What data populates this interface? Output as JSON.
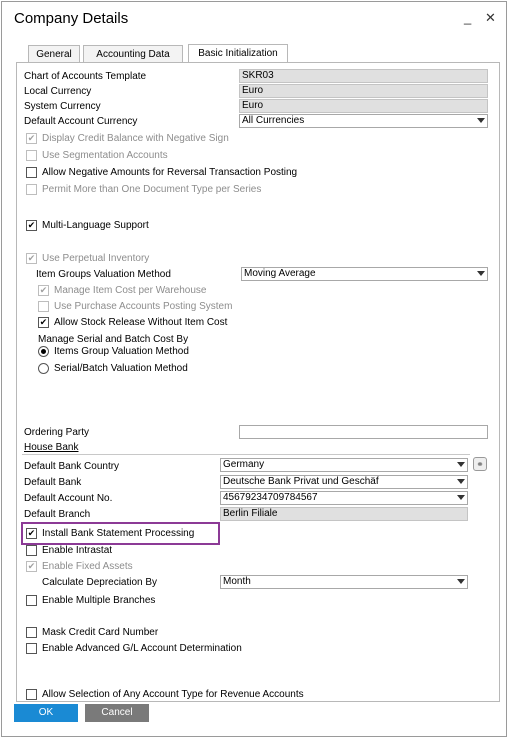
{
  "window": {
    "title": "Company Details",
    "minimize": "_",
    "close": "✕"
  },
  "tabs": [
    {
      "label": "General"
    },
    {
      "label": "Accounting Data"
    },
    {
      "label": "Basic Initialization"
    }
  ],
  "basic": {
    "chart_of_accounts_label": "Chart of Accounts Template",
    "chart_of_accounts_value": "SKR03",
    "local_currency_label": "Local Currency",
    "local_currency_value": "Euro",
    "system_currency_label": "System Currency",
    "system_currency_value": "Euro",
    "default_account_currency_label": "Default Account Currency",
    "default_account_currency_value": "All Currencies",
    "display_credit_balance": "Display Credit Balance with Negative Sign",
    "use_segmentation": "Use Segmentation Accounts",
    "allow_negative_amounts": "Allow Negative Amounts for Reversal Transaction Posting",
    "permit_multiple_doc_types": "Permit More than One Document Type per Series",
    "multi_language": "Multi-Language Support",
    "use_perpetual_inventory": "Use Perpetual Inventory",
    "item_groups_valuation_label": "Item Groups Valuation Method",
    "item_groups_valuation_value": "Moving Average",
    "manage_item_cost_per_wh": "Manage Item Cost per Warehouse",
    "use_purchase_accounts": "Use Purchase Accounts Posting System",
    "allow_stock_release": "Allow Stock Release Without Item Cost",
    "manage_serial_batch_label": "Manage Serial and Batch Cost By",
    "radio_items_group": "Items Group Valuation Method",
    "radio_serial_batch": "Serial/Batch Valuation Method",
    "ordering_party_label": "Ordering Party",
    "ordering_party_value": "",
    "house_bank_label": "House Bank",
    "default_bank_country_label": "Default Bank Country",
    "default_bank_country_value": "Germany",
    "default_bank_label": "Default Bank",
    "default_bank_value": "Deutsche Bank Privat und Geschäf",
    "default_account_no_label": "Default Account No.",
    "default_account_no_value": "45679234709784567",
    "default_branch_label": "Default Branch",
    "default_branch_value": "Berlin Filiale",
    "install_bank_statement": "Install Bank Statement Processing",
    "enable_intrastat": "Enable Intrastat",
    "enable_fixed_assets": "Enable Fixed Assets",
    "calc_depreciation_label": "Calculate Depreciation By",
    "calc_depreciation_value": "Month",
    "enable_multiple_branches": "Enable Multiple Branches",
    "mask_credit_card": "Mask Credit Card Number",
    "enable_advanced_gl": "Enable Advanced G/L Account Determination",
    "allow_any_account_type": "Allow Selection of Any Account Type for Revenue Accounts"
  },
  "buttons": {
    "ok": "OK",
    "cancel": "Cancel"
  },
  "colors": {
    "ok_button": "#1a8ad4",
    "cancel_button": "#7a7a7a",
    "highlight": "#8c3a96"
  }
}
